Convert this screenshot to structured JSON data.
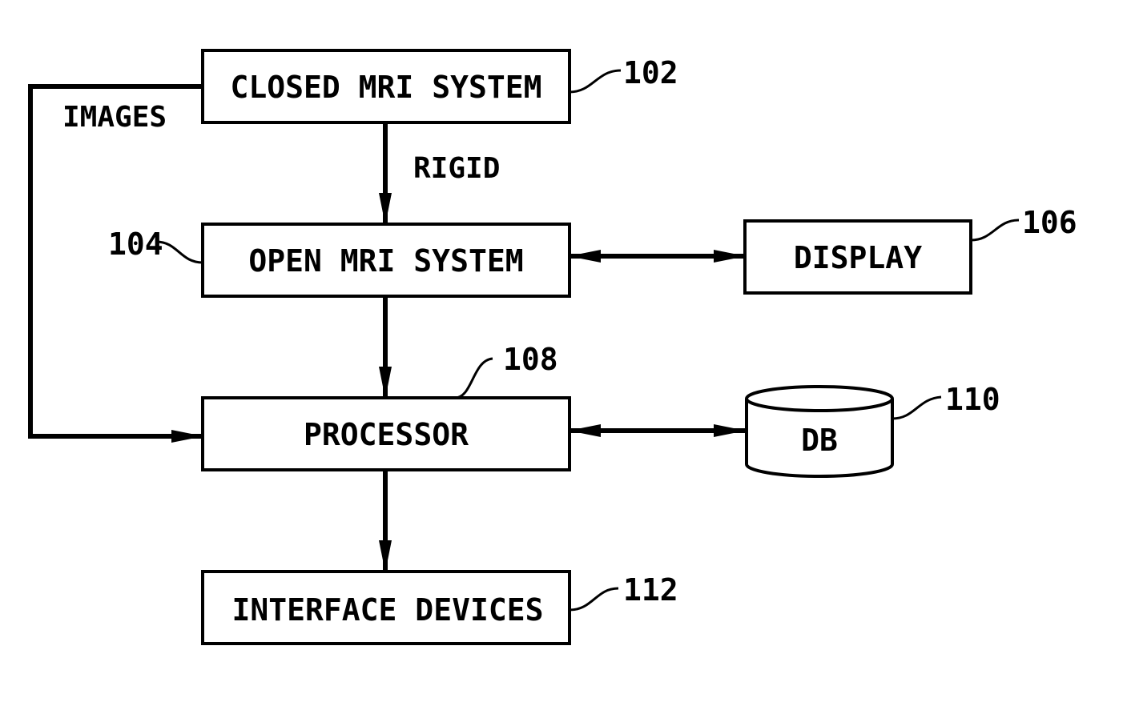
{
  "diagram": {
    "type": "block-diagram",
    "nodes": [
      {
        "id": "closed_mri",
        "label": "CLOSED MRI SYSTEM",
        "ref": "102",
        "shape": "rect"
      },
      {
        "id": "open_mri",
        "label": "OPEN MRI SYSTEM",
        "ref": "104",
        "shape": "rect"
      },
      {
        "id": "display",
        "label": "DISPLAY",
        "ref": "106",
        "shape": "rect"
      },
      {
        "id": "processor",
        "label": "PROCESSOR",
        "ref": "108",
        "shape": "rect"
      },
      {
        "id": "db",
        "label": "DB",
        "ref": "110",
        "shape": "cylinder"
      },
      {
        "id": "interface",
        "label": "INTERFACE DEVICES",
        "ref": "112",
        "shape": "rect"
      }
    ],
    "edges": [
      {
        "from": "closed_mri",
        "to": "open_mri",
        "label": "RIGID",
        "direction": "forward"
      },
      {
        "from": "closed_mri",
        "to": "processor",
        "label": "IMAGES",
        "direction": "forward"
      },
      {
        "from": "open_mri",
        "to": "display",
        "label": "",
        "direction": "bidirectional"
      },
      {
        "from": "open_mri",
        "to": "processor",
        "label": "",
        "direction": "forward"
      },
      {
        "from": "processor",
        "to": "db",
        "label": "",
        "direction": "bidirectional"
      },
      {
        "from": "processor",
        "to": "interface",
        "label": "",
        "direction": "forward"
      }
    ]
  },
  "colors": {
    "stroke": "#000000",
    "background": "#ffffff"
  }
}
